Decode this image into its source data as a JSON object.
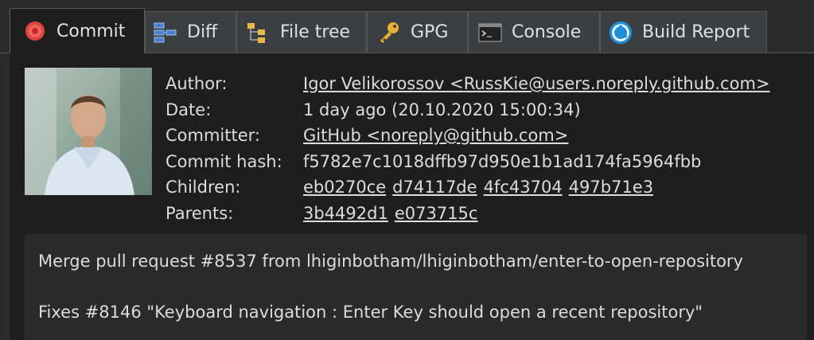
{
  "tabs": [
    {
      "label": "Commit",
      "icon": "commit-icon"
    },
    {
      "label": "Diff",
      "icon": "diff-icon"
    },
    {
      "label": "File tree",
      "icon": "file-tree-icon"
    },
    {
      "label": "GPG",
      "icon": "key-icon"
    },
    {
      "label": "Console",
      "icon": "console-icon"
    },
    {
      "label": "Build Report",
      "icon": "build-report-icon"
    }
  ],
  "commit": {
    "author_label": "Author:",
    "author": "Igor Velikorossov <RussKie@users.noreply.github.com>",
    "date_label": "Date:",
    "date": "1 day ago (20.10.2020 15:00:34)",
    "committer_label": "Committer:",
    "committer": "GitHub <noreply@github.com>",
    "hash_label": "Commit hash:",
    "hash": "f5782e7c1018dffb97d950e1b1ad174fa5964fbb",
    "children_label": "Children:",
    "children": [
      "eb0270ce",
      "d74117de",
      "4fc43704",
      "497b71e3"
    ],
    "parents_label": "Parents:",
    "parents": [
      "3b4492d1",
      "e073715c"
    ]
  },
  "message": {
    "line1": "Merge pull request #8537 from lhiginbotham/lhiginbotham/enter-to-open-repository",
    "line2": "Fixes #8146 \"Keyboard navigation : Enter Key should open a recent repository\""
  }
}
